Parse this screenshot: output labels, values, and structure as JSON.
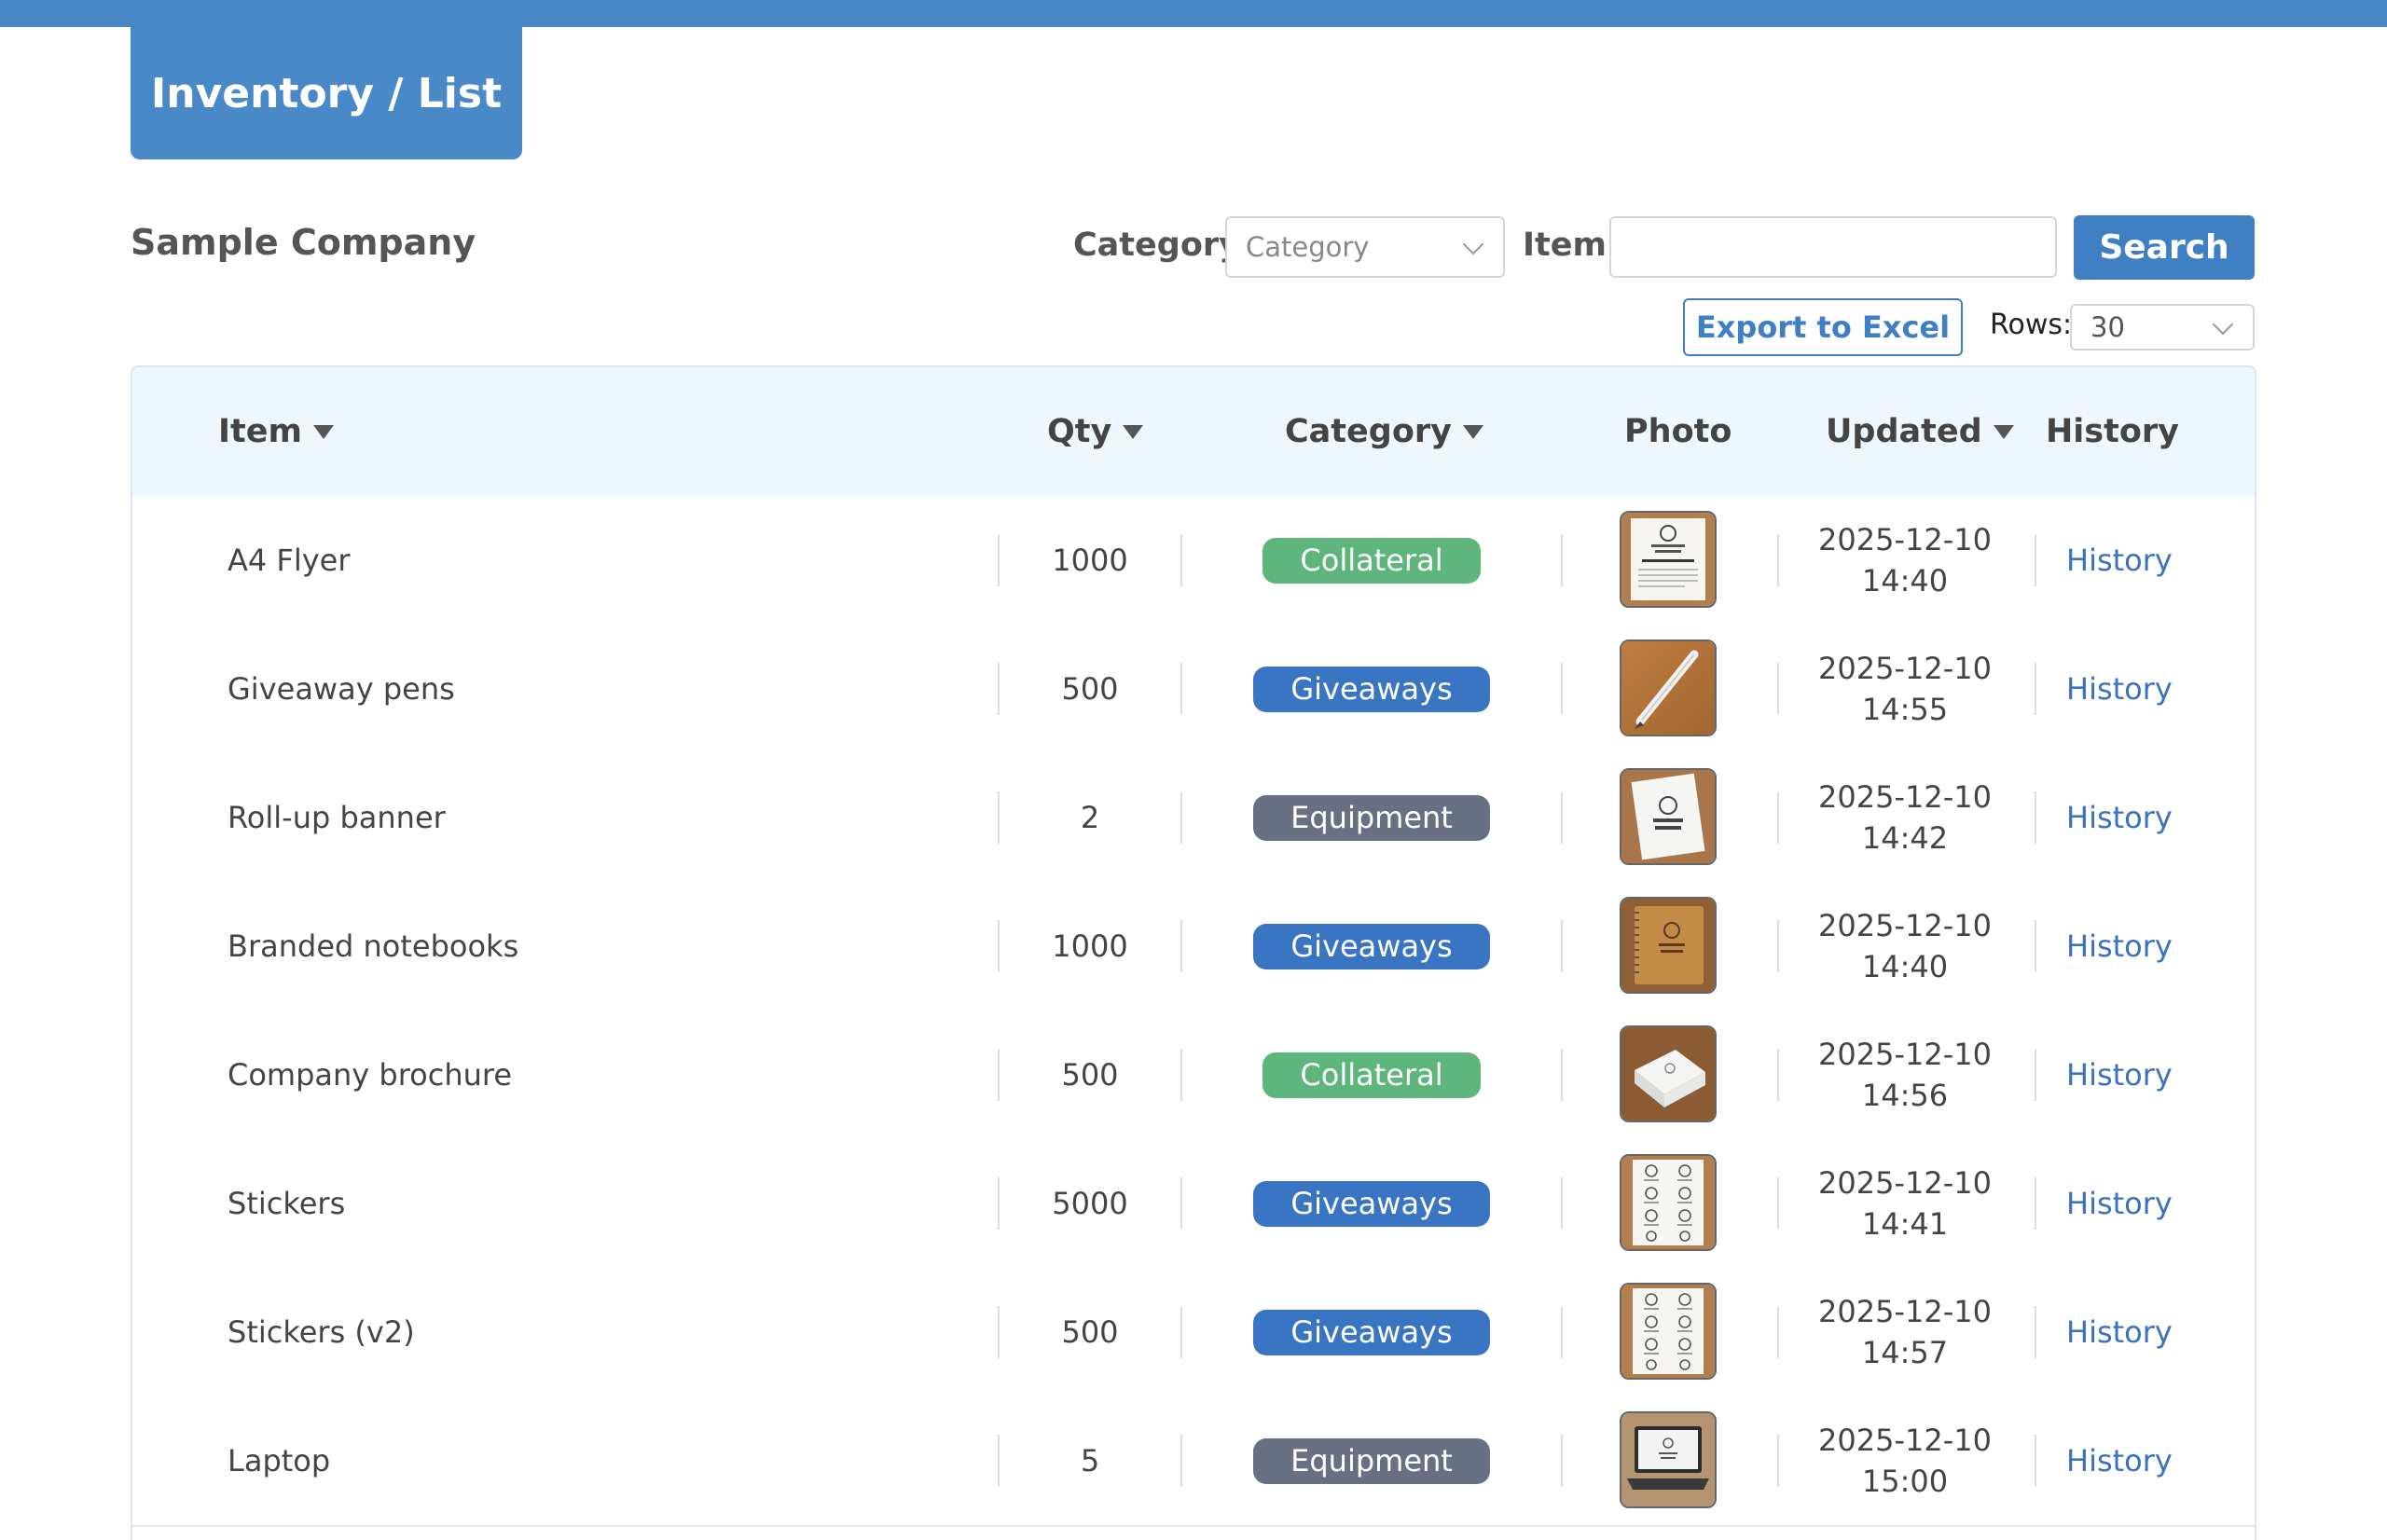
{
  "header": {
    "title": "Inventory / List"
  },
  "company": "Sample Company",
  "filters": {
    "category_label": "Category",
    "category_placeholder": "Category",
    "item_label": "Item",
    "item_value": "",
    "search_label": "Search",
    "export_label": "Export to Excel",
    "rows_label": "Rows:",
    "rows_value": "30"
  },
  "table": {
    "columns": {
      "item": "Item",
      "qty": "Qty",
      "category": "Category",
      "photo": "Photo",
      "updated": "Updated",
      "history": "History"
    },
    "rows": [
      {
        "item": "A4 Flyer",
        "qty": "1000",
        "category": "Collateral",
        "category_style": "collateral",
        "photo": "flyer-photo",
        "date": "2025-12-10",
        "time": "14:40",
        "history": "History"
      },
      {
        "item": "Giveaway pens",
        "qty": "500",
        "category": "Giveaways",
        "category_style": "giveaways",
        "photo": "pen-photo",
        "date": "2025-12-10",
        "time": "14:55",
        "history": "History"
      },
      {
        "item": "Roll-up banner",
        "qty": "2",
        "category": "Equipment",
        "category_style": "equipment",
        "photo": "banner-photo",
        "date": "2025-12-10",
        "time": "14:42",
        "history": "History"
      },
      {
        "item": "Branded notebooks",
        "qty": "1000",
        "category": "Giveaways",
        "category_style": "giveaways",
        "photo": "notebook-photo",
        "date": "2025-12-10",
        "time": "14:40",
        "history": "History"
      },
      {
        "item": "Company brochure",
        "qty": "500",
        "category": "Collateral",
        "category_style": "collateral",
        "photo": "brochure-photo",
        "date": "2025-12-10",
        "time": "14:56",
        "history": "History"
      },
      {
        "item": "Stickers",
        "qty": "5000",
        "category": "Giveaways",
        "category_style": "giveaways",
        "photo": "stickers-photo",
        "date": "2025-12-10",
        "time": "14:41",
        "history": "History"
      },
      {
        "item": "Stickers (v2)",
        "qty": "500",
        "category": "Giveaways",
        "category_style": "giveaways",
        "photo": "stickers-photo",
        "date": "2025-12-10",
        "time": "14:57",
        "history": "History"
      },
      {
        "item": "Laptop",
        "qty": "5",
        "category": "Equipment",
        "category_style": "equipment",
        "photo": "laptop-photo",
        "date": "2025-12-10",
        "time": "15:00",
        "history": "History"
      }
    ]
  },
  "colors": {
    "brand": "#4a89c8",
    "link": "#3a72c0",
    "collateral": "#5fb67d",
    "giveaways": "#3a75c4",
    "equipment": "#687183"
  }
}
